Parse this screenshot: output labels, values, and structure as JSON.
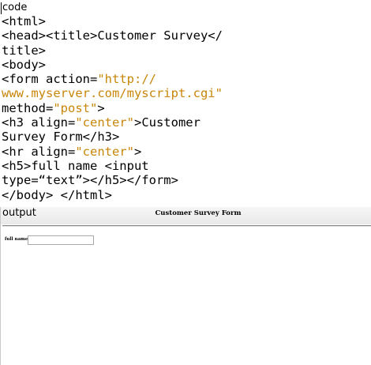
{
  "labels": {
    "code": "code",
    "output": "output"
  },
  "code": {
    "lines": [
      [
        {
          "t": "<html>",
          "c": "attr"
        }
      ],
      [
        {
          "t": "<head><title>Customer Survey</",
          "c": "attr"
        }
      ],
      [
        {
          "t": "title>",
          "c": "attr"
        }
      ],
      [
        {
          "t": "<body>",
          "c": "attr"
        }
      ],
      [
        {
          "t": "<form action=",
          "c": "attr"
        },
        {
          "t": "\"http://",
          "c": "str"
        }
      ],
      [
        {
          "t": "www.myserver.com/myscript.cgi\"",
          "c": "str"
        }
      ],
      [
        {
          "t": "method=",
          "c": "attr"
        },
        {
          "t": "\"post\"",
          "c": "str"
        },
        {
          "t": ">",
          "c": "attr"
        }
      ],
      [
        {
          "t": "<h3 align=",
          "c": "attr"
        },
        {
          "t": "\"center\"",
          "c": "str"
        },
        {
          "t": ">Customer",
          "c": "attr"
        }
      ],
      [
        {
          "t": "Survey Form</h3>",
          "c": "attr"
        }
      ],
      [
        {
          "t": "<hr align=",
          "c": "attr"
        },
        {
          "t": "\"center\"",
          "c": "str"
        },
        {
          "t": ">",
          "c": "attr"
        }
      ],
      [
        {
          "t": "<h5>full name <input",
          "c": "attr"
        }
      ],
      [
        {
          "t": "type=“text”></h5></form>",
          "c": "attr"
        }
      ],
      [
        {
          "t": "</body> </html>",
          "c": "attr"
        }
      ]
    ]
  },
  "output": {
    "heading": "Customer Survey Form",
    "field_label": "full name",
    "input_value": ""
  }
}
